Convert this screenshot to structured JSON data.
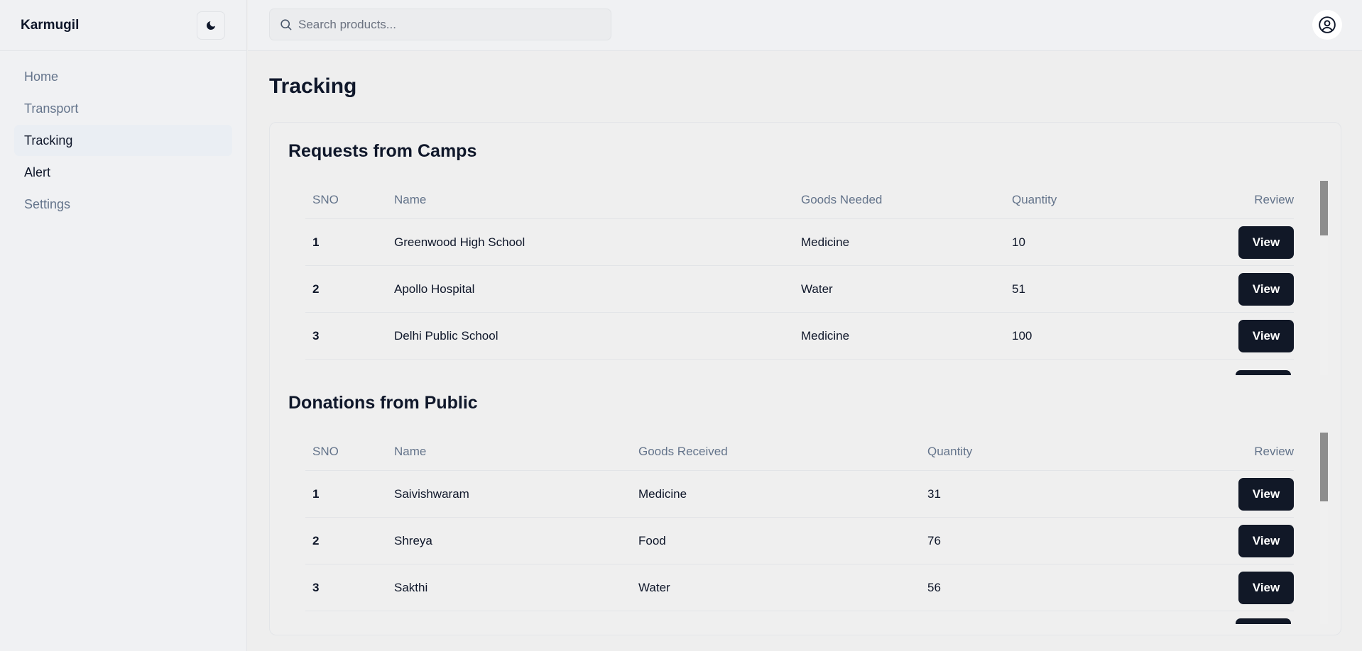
{
  "app": {
    "brand": "Karmugil"
  },
  "sidebar": {
    "items": [
      {
        "label": "Home"
      },
      {
        "label": "Transport"
      },
      {
        "label": "Tracking"
      },
      {
        "label": "Alert"
      },
      {
        "label": "Settings"
      }
    ]
  },
  "search": {
    "placeholder": "Search products..."
  },
  "page": {
    "title": "Tracking"
  },
  "requests": {
    "title": "Requests from Camps",
    "headers": [
      "SNO",
      "Name",
      "Goods Needed",
      "Quantity",
      "Review"
    ],
    "rows": [
      {
        "sno": "1",
        "name": "Greenwood High School",
        "goods": "Medicine",
        "qty": "10",
        "action": "View"
      },
      {
        "sno": "2",
        "name": "Apollo Hospital",
        "goods": "Water",
        "qty": "51",
        "action": "View"
      },
      {
        "sno": "3",
        "name": "Delhi Public School",
        "goods": "Medicine",
        "qty": "100",
        "action": "View"
      }
    ]
  },
  "donations": {
    "title": "Donations from Public",
    "headers": [
      "SNO",
      "Name",
      "Goods Received",
      "Quantity",
      "Review"
    ],
    "rows": [
      {
        "sno": "1",
        "name": "Saivishwaram",
        "goods": "Medicine",
        "qty": "31",
        "action": "View"
      },
      {
        "sno": "2",
        "name": "Shreya",
        "goods": "Food",
        "qty": "76",
        "action": "View"
      },
      {
        "sno": "3",
        "name": "Sakthi",
        "goods": "Water",
        "qty": "56",
        "action": "View"
      }
    ]
  },
  "icons": {
    "theme": "moon-icon",
    "search": "search-icon",
    "account": "user-circle-icon"
  }
}
